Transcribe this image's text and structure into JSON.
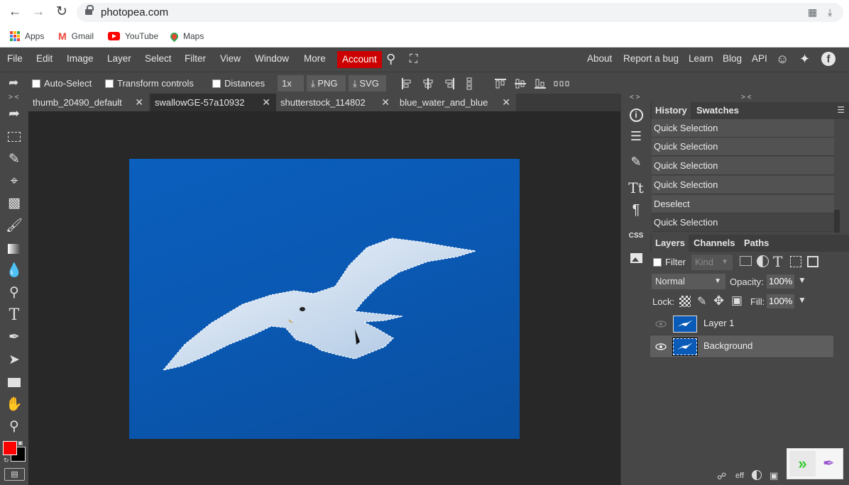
{
  "browser": {
    "url": "photopea.com",
    "bookmarks": [
      {
        "label": "Apps"
      },
      {
        "label": "Gmail"
      },
      {
        "label": "YouTube"
      },
      {
        "label": "Maps"
      }
    ]
  },
  "menu": {
    "items": [
      "File",
      "Edit",
      "Image",
      "Layer",
      "Select",
      "Filter",
      "View",
      "Window",
      "More"
    ],
    "account_label": "Account",
    "right_links": [
      "About",
      "Report a bug",
      "Learn",
      "Blog",
      "API"
    ]
  },
  "options": {
    "auto_select": "Auto-Select",
    "transform_controls": "Transform controls",
    "distances": "Distances",
    "zoom": "1x",
    "png": "PNG",
    "svg": "SVG"
  },
  "tabs": [
    {
      "label": "thumb_20490_default",
      "active": false
    },
    {
      "label": "swallowGE-57a10932",
      "active": true
    },
    {
      "label": "shutterstock_114802",
      "active": false
    },
    {
      "label": "blue_water_and_blue",
      "active": false
    }
  ],
  "panel_collapse": "> <",
  "mini_collapse": "< >",
  "left_collapse": "> <",
  "history": {
    "tabs": [
      "History",
      "Swatches"
    ],
    "items": [
      "Quick Selection",
      "Quick Selection",
      "Quick Selection",
      "Quick Selection",
      "Deselect",
      "Quick Selection"
    ]
  },
  "layers": {
    "tabs": [
      "Layers",
      "Channels",
      "Paths"
    ],
    "filter_label": "Filter",
    "kind_label": "Kind",
    "blend_mode": "Normal",
    "opacity_label": "Opacity:",
    "opacity_value": "100%",
    "lock_label": "Lock:",
    "fill_label": "Fill:",
    "fill_value": "100%",
    "items": [
      {
        "name": "Layer 1",
        "visible": false,
        "selected": false
      },
      {
        "name": "Background",
        "visible": true,
        "selected": true
      }
    ],
    "bottom_eff": "eff"
  },
  "mini_css": "CSS",
  "colors": {
    "foreground": "#ff0000",
    "background": "#000000",
    "canvas": "#0a58b2",
    "account": "#cc0000"
  }
}
